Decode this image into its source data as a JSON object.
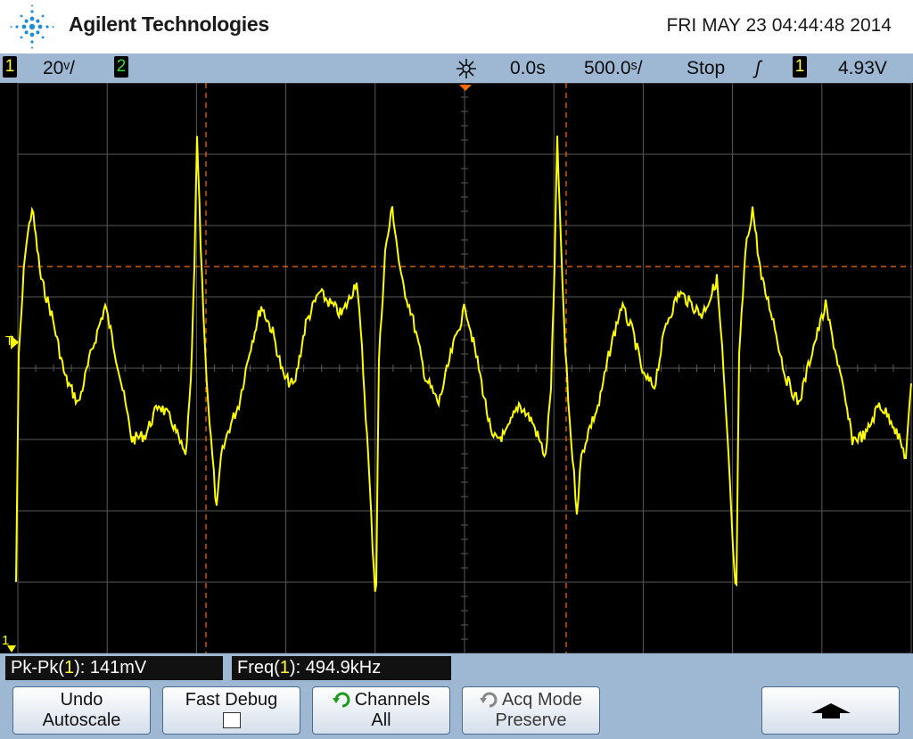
{
  "header": {
    "brand": "Agilent Technologies",
    "datetime": "FRI MAY 23 04:44:48 2014"
  },
  "status": {
    "ch1_num": "1",
    "ch1_scale": "20ᵛ/",
    "ch2_num": "2",
    "trigger_delay": "0.0s",
    "timebase": "500.0ˢ/",
    "run_state": "Stop",
    "trigger_edge_symbol": "ʃ",
    "trigger_source": "1",
    "trigger_level": "4.93V"
  },
  "markers": {
    "trigger_level_marker": "T",
    "ch1_ground_marker": "1"
  },
  "measurements": [
    {
      "prefix": "Pk-Pk(",
      "channel": "1",
      "suffix": "): 141mV"
    },
    {
      "prefix": "Freq(",
      "channel": "1",
      "suffix": "): 494.9kHz"
    }
  ],
  "softkeys": {
    "undo_autoscale": {
      "line1": "Undo",
      "line2": "Autoscale"
    },
    "fast_debug": {
      "line1": "Fast Debug"
    },
    "channels": {
      "line1": "Channels",
      "line2": "All"
    },
    "acq_mode": {
      "line1": "Acq Mode",
      "line2": "Preserve"
    },
    "up_arrow": {
      "symbol": "▲"
    }
  },
  "colors": {
    "trace_ch1": "#ffff00",
    "cursor": "#ff6a00",
    "grid": "#5a5a5a",
    "bar_bg": "#9eb8d4"
  },
  "waveform": {
    "cycles_visible": 2,
    "description_free": true
  }
}
